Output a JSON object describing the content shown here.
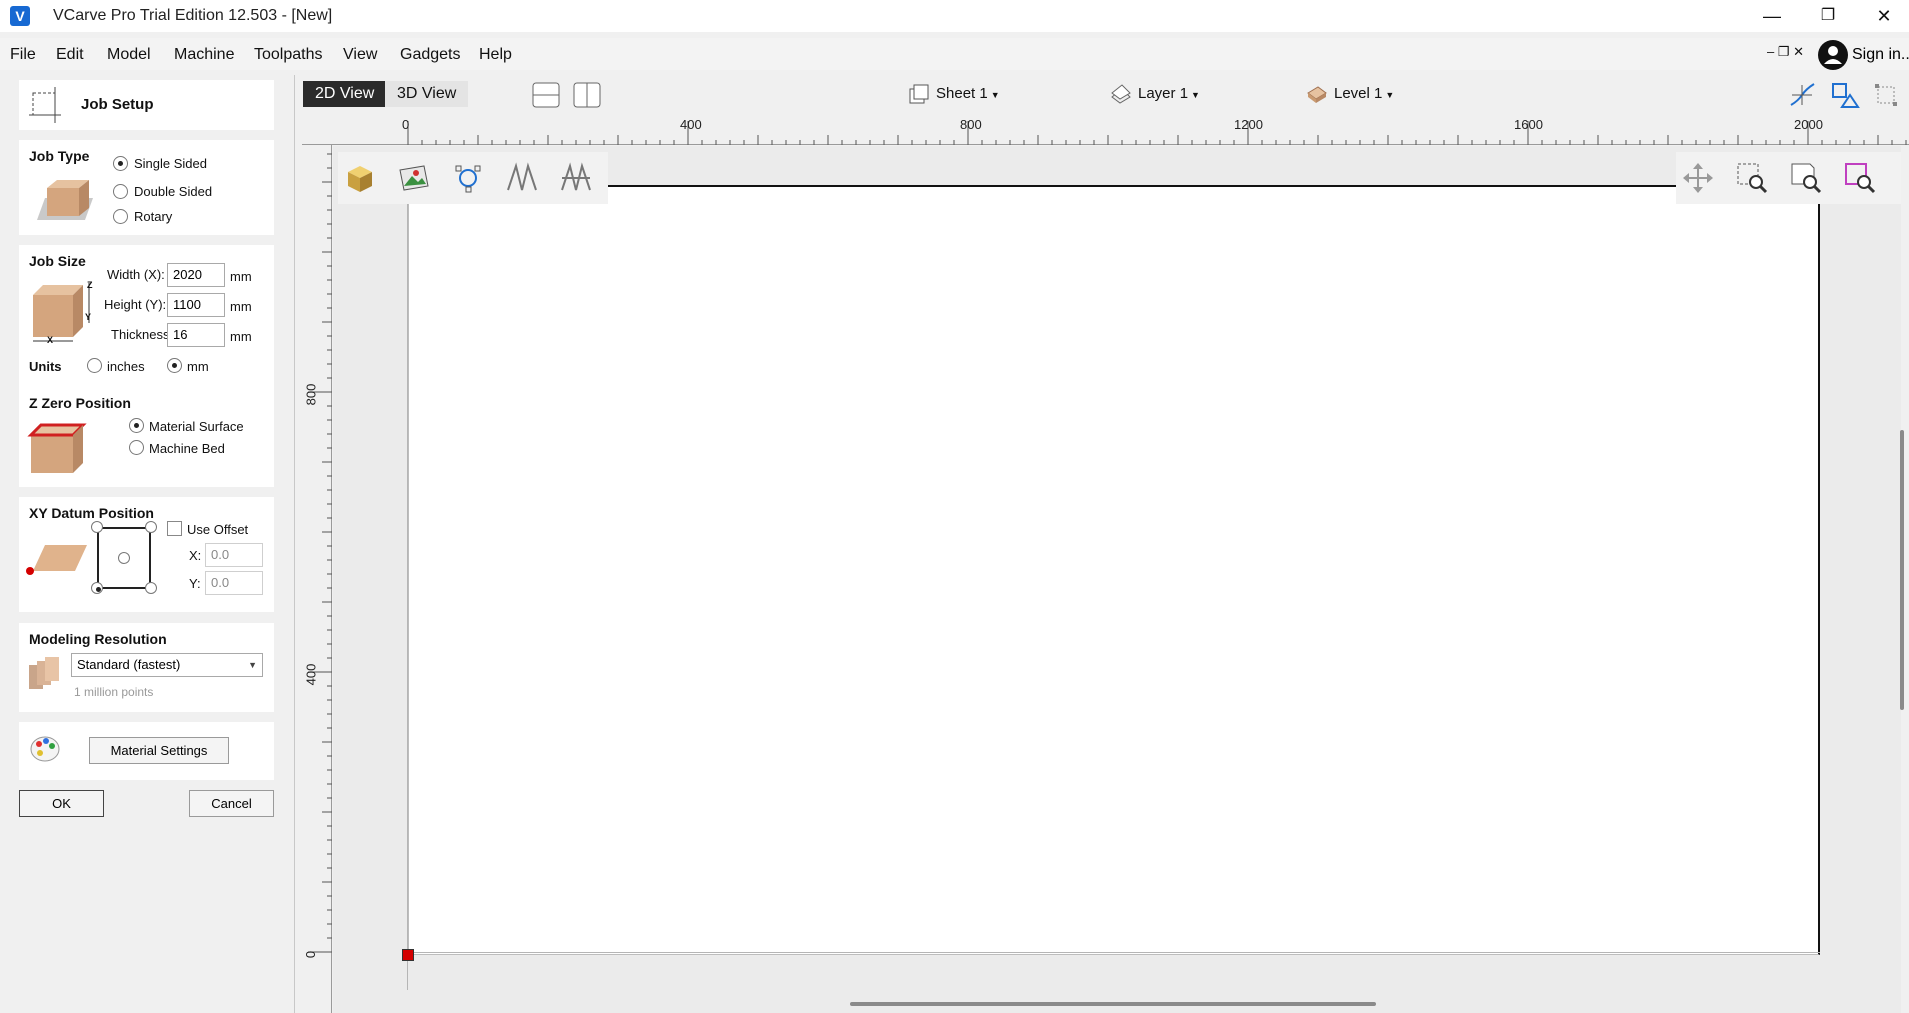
{
  "window": {
    "title": "VCarve Pro Trial Edition 12.503 - [New]",
    "app_icon_glyph": "V",
    "minimize": "—",
    "restore": "❐",
    "close": "✕"
  },
  "menubar": {
    "items": [
      "File",
      "Edit",
      "Model",
      "Machine",
      "Toolpaths",
      "View",
      "Gadgets",
      "Help"
    ],
    "mdi_controls": "–  ❐  ✕",
    "signin_label": "Sign in..."
  },
  "job_setup": {
    "title": "Job Setup",
    "job_type": {
      "title": "Job Type",
      "options": [
        "Single Sided",
        "Double Sided",
        "Rotary"
      ],
      "selected": "Single Sided"
    },
    "job_size": {
      "title": "Job Size",
      "width_label": "Width (X):",
      "width_value": "2020",
      "height_label": "Height (Y):",
      "height_value": "1100",
      "thickness_label": "Thickness",
      "thickness_value": "16",
      "unit": "mm",
      "units_label": "Units",
      "units_options": [
        "inches",
        "mm"
      ],
      "units_selected": "mm",
      "axis_z": "Z",
      "axis_y": "Y",
      "axis_x": "X"
    },
    "z_zero": {
      "title": "Z Zero Position",
      "options": [
        "Material Surface",
        "Machine Bed"
      ],
      "selected": "Material Surface"
    },
    "xy_datum": {
      "title": "XY Datum Position",
      "use_offset_label": "Use Offset",
      "use_offset_checked": false,
      "x_label": "X:",
      "x_value": "0.0",
      "y_label": "Y:",
      "y_value": "0.0",
      "selected_corner": "bottom-left"
    },
    "modeling_resolution": {
      "title": "Modeling Resolution",
      "selected": "Standard (fastest)",
      "note": "1 million points"
    },
    "material_settings_label": "Material Settings",
    "ok_label": "OK",
    "cancel_label": "Cancel"
  },
  "view": {
    "tabs": [
      "2D View",
      "3D View"
    ],
    "active_tab": "2D View",
    "sheet_label": "Sheet 1",
    "layer_label": "Layer 1",
    "level_label": "Level 1",
    "ruler_top_ticks": [
      "0",
      "400",
      "800",
      "1200",
      "1600",
      "2000"
    ],
    "ruler_left_ticks": [
      "800",
      "400",
      "0"
    ],
    "corner_glyph": "-¦-"
  },
  "colors": {
    "datum_marker": "#d40000",
    "active_tab_bg": "#2b2b2b",
    "app_icon": "#1769d2",
    "material_rect_border": "#e02020",
    "material_fill": "#d9b48f"
  }
}
